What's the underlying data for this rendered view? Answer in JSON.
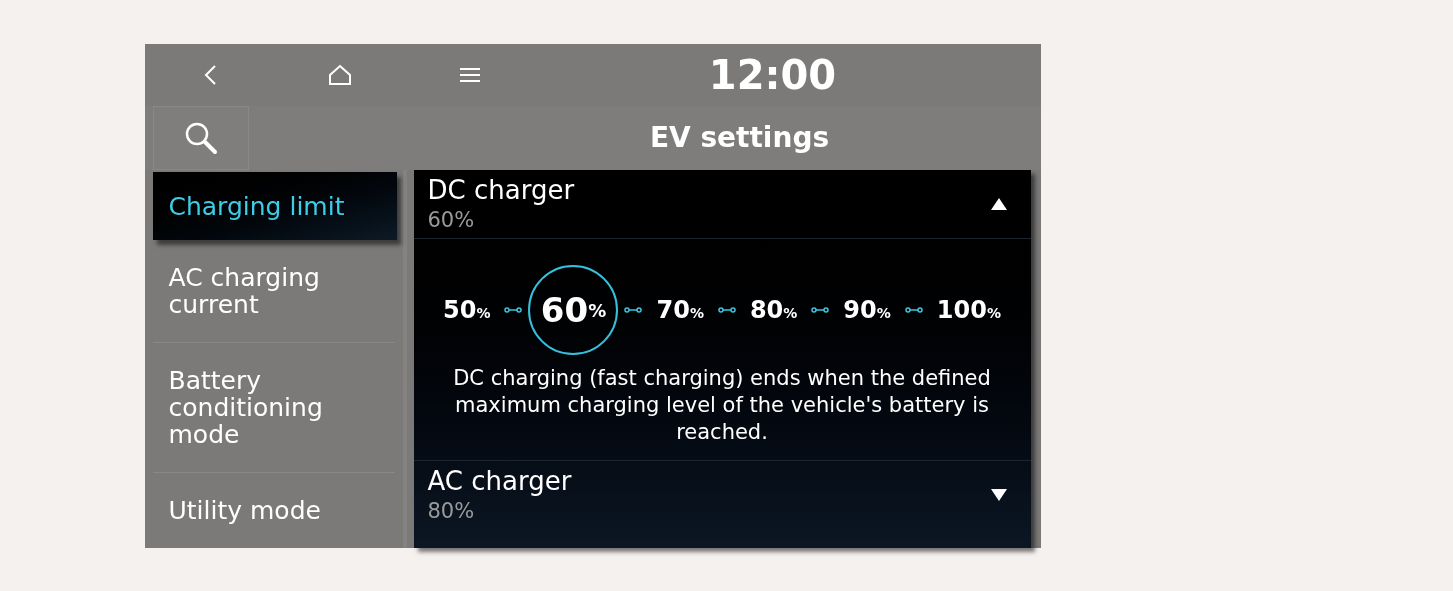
{
  "clock": "12:00",
  "title": "EV settings",
  "sidebar": {
    "items": [
      {
        "label": "Charging limit",
        "selected": true
      },
      {
        "label": "AC charging current",
        "selected": false
      },
      {
        "label": "Battery conditioning mode",
        "selected": false
      },
      {
        "label": "Utility mode",
        "selected": false
      }
    ]
  },
  "sections": [
    {
      "title": "DC charger",
      "value": "60%",
      "expanded": true,
      "options": [
        {
          "value": "50",
          "unit": "%",
          "selected": false
        },
        {
          "value": "60",
          "unit": "%",
          "selected": true
        },
        {
          "value": "70",
          "unit": "%",
          "selected": false
        },
        {
          "value": "80",
          "unit": "%",
          "selected": false
        },
        {
          "value": "90",
          "unit": "%",
          "selected": false
        },
        {
          "value": "100",
          "unit": "%",
          "selected": false
        }
      ],
      "description": "DC charging (fast charging) ends when the defined maximum charging level of the vehicle's battery is reached."
    },
    {
      "title": "AC charger",
      "value": "80%",
      "expanded": false
    }
  ]
}
